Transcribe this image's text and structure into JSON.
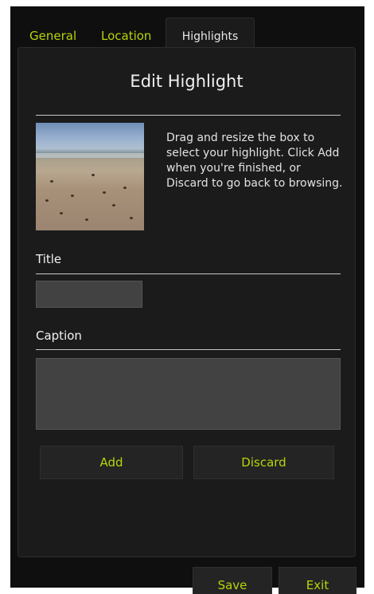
{
  "tabs": [
    {
      "label": "General",
      "active": false
    },
    {
      "label": "Location",
      "active": false
    },
    {
      "label": "Highlights",
      "active": true
    }
  ],
  "panel": {
    "title": "Edit Highlight",
    "thumbnail_icon": "beach-photo-thumbnail",
    "description": "Drag and resize the box to select your highlight. Click Add when you're finished, or Discard to go back to browsing.",
    "title_label": "Title",
    "title_value": "",
    "caption_label": "Caption",
    "caption_value": "",
    "add_label": "Add",
    "discard_label": "Discard"
  },
  "footer": {
    "save_label": "Save",
    "exit_label": "Exit"
  },
  "colors": {
    "accent": "#b8d40a",
    "background": "#0f0f0f",
    "panel": "#1b1b1b",
    "input": "#424242",
    "text": "#f0f0f0"
  }
}
